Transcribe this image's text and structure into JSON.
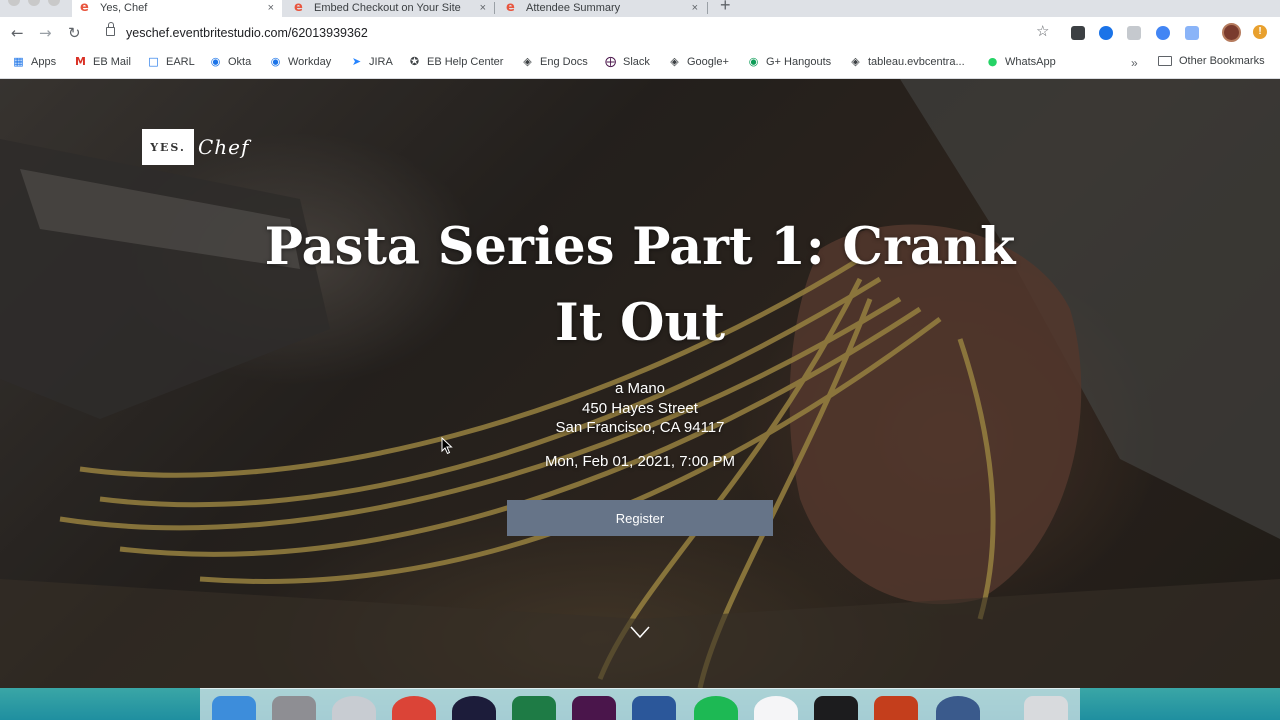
{
  "browser": {
    "tabs": [
      {
        "title": "Yes, Chef",
        "active": true
      },
      {
        "title": "Embed Checkout on Your Site",
        "active": false
      },
      {
        "title": "Attendee Summary",
        "active": false
      }
    ],
    "tab_favicon": "e",
    "tab_close": "×",
    "new_tab": "+",
    "url": "yeschef.eventbritestudio.com/62013939362",
    "bookmarks": [
      {
        "label": "Apps",
        "icon": "apps-grid-icon"
      },
      {
        "label": "EB Mail",
        "icon": "gmail-icon"
      },
      {
        "label": "EARL",
        "icon": "calendar-icon"
      },
      {
        "label": "Okta",
        "icon": "okta-icon"
      },
      {
        "label": "Workday",
        "icon": "workday-icon"
      },
      {
        "label": "JIRA",
        "icon": "jira-icon"
      },
      {
        "label": "EB Help Center",
        "icon": "help-center-icon"
      },
      {
        "label": "Eng Docs",
        "icon": "globe-icon"
      },
      {
        "label": "Slack",
        "icon": "slack-icon"
      },
      {
        "label": "Google+",
        "icon": "globe-icon"
      },
      {
        "label": "G+ Hangouts",
        "icon": "hangouts-icon"
      },
      {
        "label": "tableau.evbcentra...",
        "icon": "globe-icon"
      },
      {
        "label": "WhatsApp",
        "icon": "whatsapp-icon"
      }
    ],
    "bookmarks_more": "»",
    "other_bookmarks": "Other Bookmarks"
  },
  "hero": {
    "logo_box": "YES.",
    "logo_script": "Chef",
    "title_line1": "Pasta Series Part 1: Crank",
    "title_line2": "It Out",
    "venue_name": "a Mano",
    "venue_street": "450 Hayes Street",
    "venue_city": "San Francisco,  CA 94117",
    "datetime": "Mon, Feb 01, 2021, 7:00 PM",
    "register_label": "Register"
  },
  "colors": {
    "register_bg": "#667488",
    "tab_favicon": "#e8553e"
  }
}
